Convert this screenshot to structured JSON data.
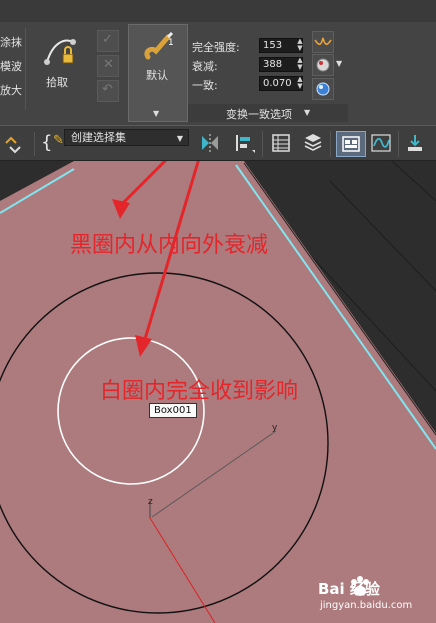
{
  "ribbon": {
    "left_labels": [
      "涂抹",
      "模波",
      "放大"
    ],
    "pick_label": "拾取",
    "default_label": "默认",
    "full_strength_label": "完全强度:",
    "full_strength_value": "153",
    "falloff_label": "衰减:",
    "falloff_value": "388",
    "consistency_label": "一致:",
    "consistency_value": "0.070",
    "section_label": "变换一致选项"
  },
  "toolbar": {
    "brace_icon": "{",
    "selection_set_value": "创建选择集"
  },
  "viewport": {
    "annotation_black": "黑圈内从内向外衰减",
    "annotation_white": "白圈内完全收到影响",
    "object_label": "Box001",
    "axis_y": "y",
    "axis_z": "z"
  },
  "watermark": {
    "brand": "Bai 经验",
    "url": "jingyan.baidu.com"
  },
  "colors": {
    "annotation": "#e4262b",
    "plane": "#ad7a7d",
    "plane_edge": "#7fe6f0",
    "ribbon": "#444444",
    "toolbar": "#3e3e3e"
  }
}
